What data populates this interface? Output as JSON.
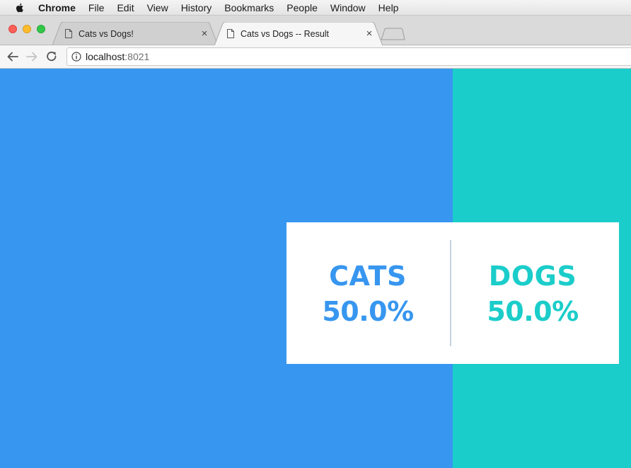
{
  "menubar": {
    "items": [
      "Chrome",
      "File",
      "Edit",
      "View",
      "History",
      "Bookmarks",
      "People",
      "Window",
      "Help"
    ]
  },
  "tabs": [
    {
      "title": "Cats vs Dogs!",
      "active": false
    },
    {
      "title": "Cats vs Dogs -- Result",
      "active": true
    }
  ],
  "address_bar": {
    "host": "localhost",
    "port": ":8021"
  },
  "result": {
    "cats": {
      "label": "CATS",
      "percent": "50.0%",
      "share": 0.5
    },
    "dogs": {
      "label": "DOGS",
      "percent": "50.0%",
      "share": 0.5
    }
  },
  "colors": {
    "cats": "#3796ef",
    "dogs": "#1bcdca"
  },
  "icons": {
    "apple": "apple-icon",
    "tab_page": "page-icon",
    "tab_close": "close-icon",
    "back": "back-arrow-icon",
    "forward": "forward-arrow-icon",
    "reload": "reload-icon",
    "info": "info-icon"
  }
}
